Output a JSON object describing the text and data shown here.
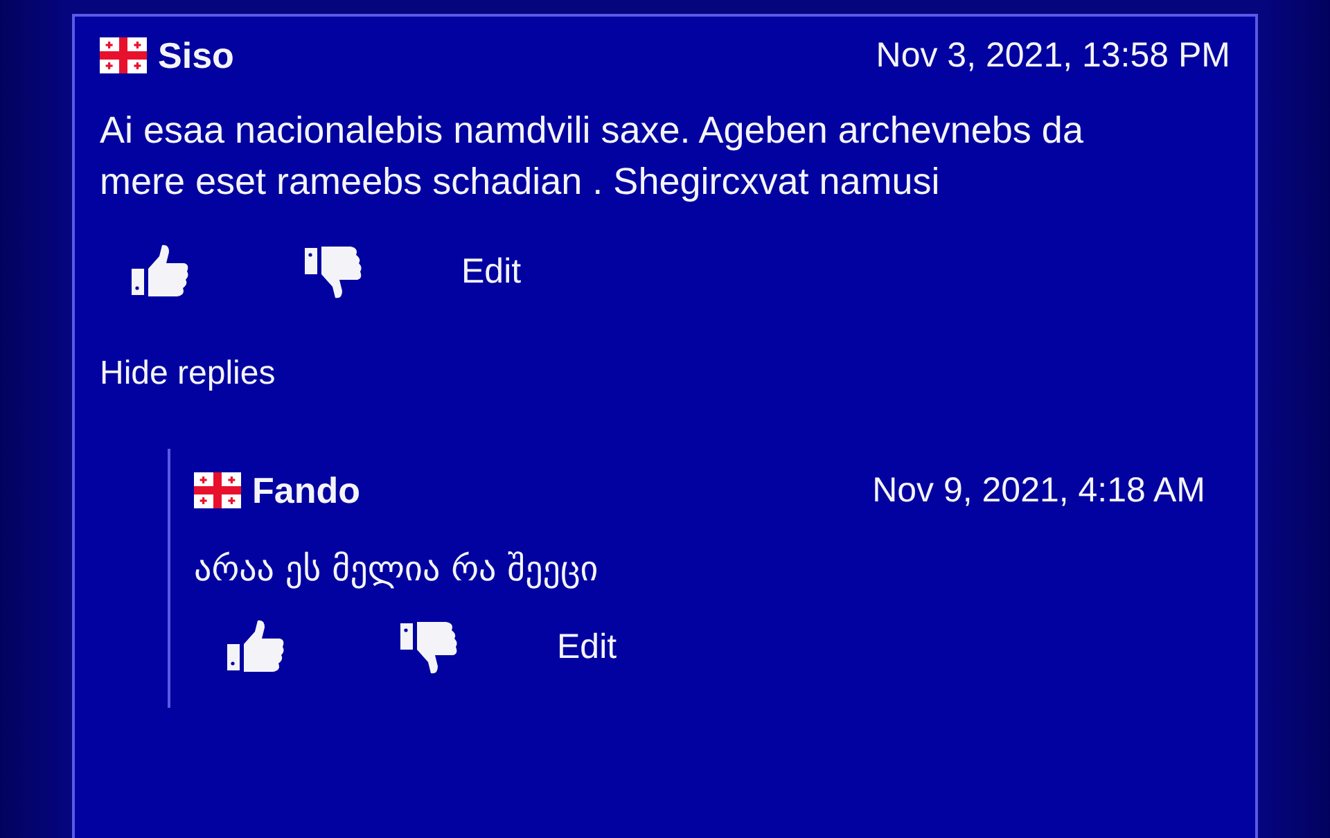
{
  "comment": {
    "author": "Siso",
    "date": "Nov 3, 2021, 13:58 PM",
    "text": "Ai esaa nacionalebis namdvili saxe. Ageben archevnebs da mere eset rameebs schadian . Shegircxvat namusi",
    "edit_label": "Edit"
  },
  "hide_replies": "Hide replies",
  "replies": [
    {
      "author": "Fando",
      "date": "Nov 9, 2021, 4:18 AM",
      "text": "არაა ეს მელია რა შეეცი",
      "edit_label": "Edit"
    }
  ]
}
